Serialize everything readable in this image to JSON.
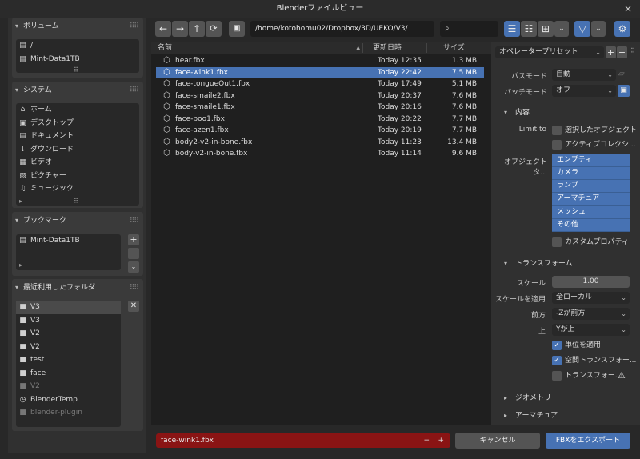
{
  "window": {
    "title": "Blenderファイルビュー",
    "close": "×"
  },
  "sidebar": {
    "volumes": {
      "title": "ボリューム",
      "items": [
        {
          "icon": "drive-icon",
          "label": "/"
        },
        {
          "icon": "drive-icon",
          "label": "Mint-Data1TB"
        }
      ]
    },
    "system": {
      "title": "システム",
      "items": [
        {
          "icon": "home-icon",
          "label": "ホーム"
        },
        {
          "icon": "desktop-icon",
          "label": "デスクトップ"
        },
        {
          "icon": "documents-icon",
          "label": "ドキュメント"
        },
        {
          "icon": "download-icon",
          "label": "ダウンロード"
        },
        {
          "icon": "video-icon",
          "label": "ビデオ"
        },
        {
          "icon": "picture-icon",
          "label": "ピクチャー"
        },
        {
          "icon": "music-icon",
          "label": "ミュージック"
        }
      ]
    },
    "bookmarks": {
      "title": "ブックマーク",
      "items": [
        {
          "icon": "drive-icon",
          "label": "Mint-Data1TB"
        }
      ]
    },
    "recent": {
      "title": "最近利用したフォルダ",
      "items": [
        {
          "icon": "folder-icon",
          "label": "V3",
          "selected": true
        },
        {
          "icon": "folder-icon",
          "label": "V3"
        },
        {
          "icon": "folder-icon",
          "label": "V2"
        },
        {
          "icon": "folder-icon",
          "label": "V2"
        },
        {
          "icon": "folder-icon",
          "label": "test"
        },
        {
          "icon": "folder-icon",
          "label": "face"
        },
        {
          "icon": "folder-icon",
          "label": "V2",
          "dim": true
        },
        {
          "icon": "clock-icon",
          "label": "BlenderTemp"
        },
        {
          "icon": "folder-icon",
          "label": "blender-plugin",
          "dim": true
        }
      ]
    }
  },
  "toolbar": {
    "path": "/home/kotohomu02/Dropbox/3D/UEKO/V3/",
    "search_placeholder": ""
  },
  "files": {
    "columns": {
      "name": "名前",
      "date": "更新日時",
      "size": "サイズ"
    },
    "rows": [
      {
        "name": "hear.fbx",
        "date": "Today 12:35",
        "size": "1.3 MB"
      },
      {
        "name": "face-wink1.fbx",
        "date": "Today 22:42",
        "size": "7.5 MB",
        "selected": true
      },
      {
        "name": "face-tongueOut1.fbx",
        "date": "Today 17:49",
        "size": "5.1 MB"
      },
      {
        "name": "face-smaile2.fbx",
        "date": "Today 20:37",
        "size": "7.6 MB"
      },
      {
        "name": "face-smaile1.fbx",
        "date": "Today 20:16",
        "size": "7.6 MB"
      },
      {
        "name": "face-boo1.fbx",
        "date": "Today 20:22",
        "size": "7.7 MB"
      },
      {
        "name": "face-azen1.fbx",
        "date": "Today 20:19",
        "size": "7.7 MB"
      },
      {
        "name": "body2-v2-in-bone.fbx",
        "date": "Today 11:23",
        "size": "13.4 MB"
      },
      {
        "name": "body-v2-in-bone.fbx",
        "date": "Today 11:14",
        "size": "9.6 MB"
      }
    ]
  },
  "options": {
    "preset": "オペレータープリセット",
    "path_mode_label": "パスモード",
    "path_mode": "自動",
    "batch_mode_label": "バッチモード",
    "batch_mode": "オフ",
    "include_section": "内容",
    "limit_to_label": "Limit to",
    "limit_selected": "選択したオブジェクト",
    "limit_active": "アクティブコレクシ...",
    "object_types_label": "オブジェクトタ...",
    "object_types": [
      "エンプティ",
      "カメラ",
      "ランプ",
      "アーマチュア",
      "メッシュ",
      "その他"
    ],
    "custom_props": "カスタムプロパティ",
    "transform_section": "トランスフォーム",
    "scale_label": "スケール",
    "scale": "1.00",
    "apply_scaling_label": "スケールを適用",
    "apply_scaling": "全ローカル",
    "forward_label": "前方",
    "forward": "-Zが前方",
    "up_label": "上",
    "up": "Yが上",
    "apply_unit": "単位を適用",
    "space_transform": "空間トランスフォー...",
    "apply_transform": "トランスフォー...",
    "geometry_section": "ジオメトリ",
    "armature_section": "アーマチュア"
  },
  "bottom": {
    "filename": "face-wink1.fbx",
    "cancel": "キャンセル",
    "export": "FBXをエクスポート"
  }
}
